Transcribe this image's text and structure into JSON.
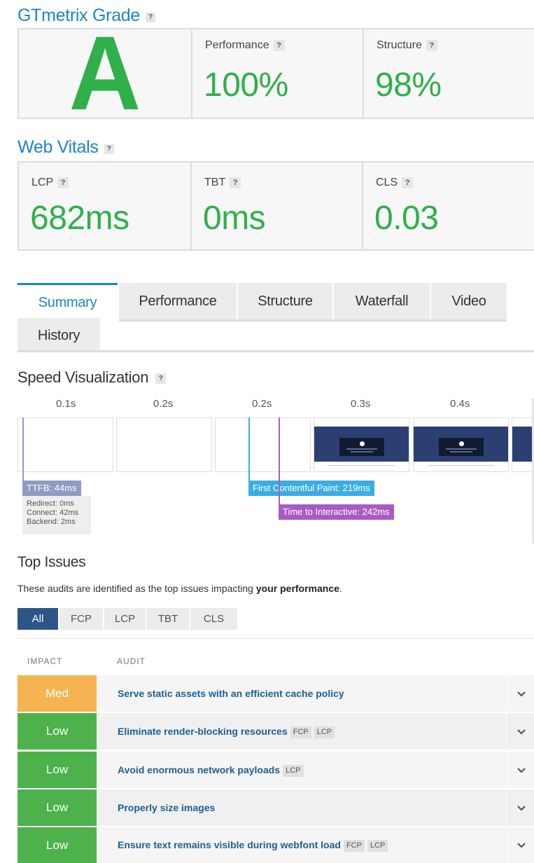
{
  "grade": {
    "title": "GTmetrix Grade",
    "help": "?",
    "letter": "A",
    "performance": {
      "label": "Performance",
      "value": "100%"
    },
    "structure": {
      "label": "Structure",
      "value": "98%"
    }
  },
  "vitals": {
    "title": "Web Vitals",
    "help": "?",
    "lcp": {
      "label": "LCP",
      "value": "682ms"
    },
    "tbt": {
      "label": "TBT",
      "value": "0ms"
    },
    "cls": {
      "label": "CLS",
      "value": "0.03"
    }
  },
  "tabs": [
    "Summary",
    "Performance",
    "Structure",
    "Waterfall",
    "Video",
    "History"
  ],
  "speed": {
    "title": "Speed Visualization",
    "ticks": [
      "0.1s",
      "0.2s",
      "0.2s",
      "0.3s",
      "0.4s"
    ],
    "ttfb": "TTFB: 44ms",
    "ttfb_details": [
      "Redirect: 0ms",
      "Connect: 42ms",
      "Backend: 2ms"
    ],
    "fcp": "First Contentful Paint: 219ms",
    "tti": "Time to Interactive: 242ms"
  },
  "issues": {
    "title": "Top Issues",
    "desc_prefix": "These audits are identified as the top issues impacting ",
    "desc_bold": "your performance",
    "desc_suffix": ".",
    "filters": [
      "All",
      "FCP",
      "LCP",
      "TBT",
      "CLS"
    ],
    "col_impact": "IMPACT",
    "col_audit": "AUDIT",
    "rows": [
      {
        "impact": "Med",
        "audit": "Serve static assets with an efficient cache policy",
        "tags": []
      },
      {
        "impact": "Low",
        "audit": "Eliminate render-blocking resources",
        "tags": [
          "FCP",
          "LCP"
        ]
      },
      {
        "impact": "Low",
        "audit": "Avoid enormous network payloads",
        "tags": [
          "LCP"
        ]
      },
      {
        "impact": "Low",
        "audit": "Properly size images",
        "tags": []
      },
      {
        "impact": "Low",
        "audit": "Ensure text remains visible during webfont load",
        "tags": [
          "FCP",
          "LCP"
        ]
      }
    ]
  },
  "colors": {
    "accent": "#1a86c8",
    "good": "#2fb04a",
    "med": "#f6b352",
    "low": "#4db14c",
    "ttfb": "#8f9bc0",
    "fcp": "#3aaee4",
    "tti": "#a85cc3"
  }
}
